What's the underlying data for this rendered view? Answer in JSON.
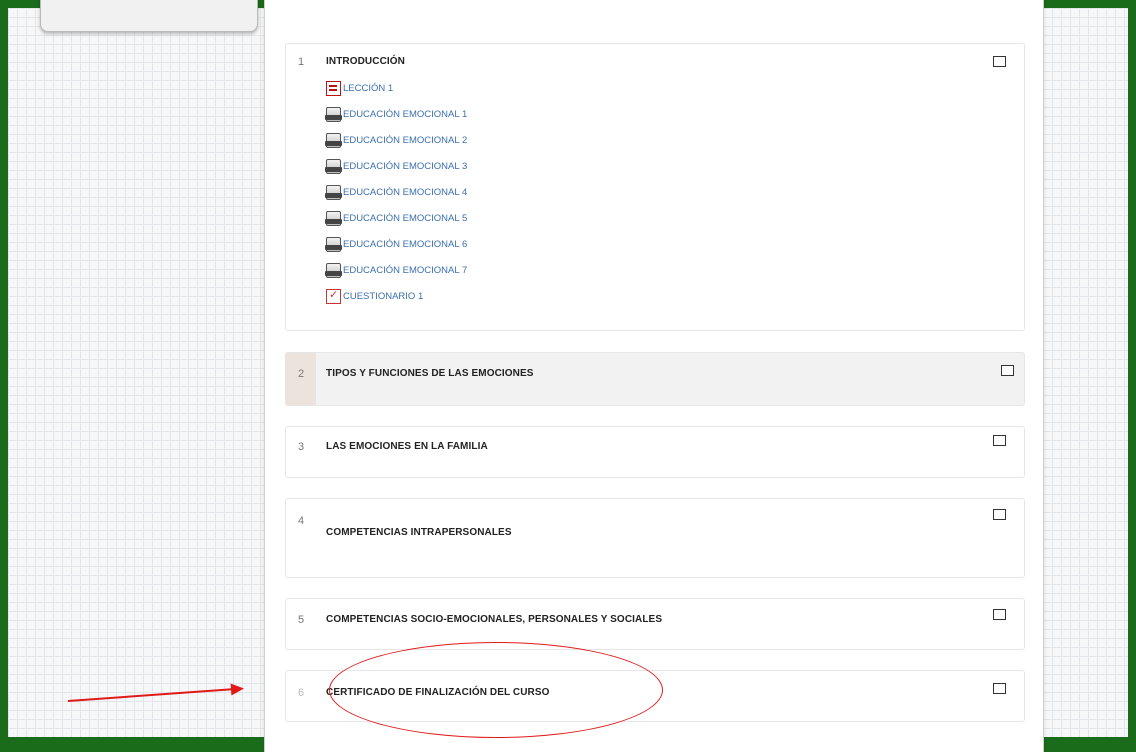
{
  "sections": [
    {
      "number": "1",
      "title": "INTRODUCCIÓN"
    },
    {
      "number": "2",
      "title": "TIPOS Y FUNCIONES DE LAS EMOCIONES"
    },
    {
      "number": "3",
      "title": "LAS EMOCIONES EN LA FAMILIA"
    },
    {
      "number": "4",
      "title": "COMPETENCIAS INTRAPERSONALES"
    },
    {
      "number": "5",
      "title": "COMPETENCIAS SOCIO-EMOCIONALES, PERSONALES Y SOCIALES"
    },
    {
      "number": "6",
      "title": "CERTIFICADO DE FINALIZACIÓN DEL CURSO"
    }
  ],
  "activities": [
    {
      "label": "LECCIÓN 1",
      "icon": "lesson-icon"
    },
    {
      "label": "EDUCACIÓN EMOCIONAL 1",
      "icon": "document-icon"
    },
    {
      "label": "EDUCACIÓN EMOCIONAL 2",
      "icon": "document-icon"
    },
    {
      "label": "EDUCACIÓN EMOCIONAL 3",
      "icon": "document-icon"
    },
    {
      "label": "EDUCACIÓN EMOCIONAL 4",
      "icon": "document-icon"
    },
    {
      "label": "EDUCACIÓN EMOCIONAL 5",
      "icon": "document-icon"
    },
    {
      "label": "EDUCACIÓN EMOCIONAL 6",
      "icon": "document-icon"
    },
    {
      "label": "EDUCACIÓN EMOCIONAL 7",
      "icon": "document-icon"
    },
    {
      "label": "CUESTIONARIO 1",
      "icon": "quiz-icon"
    }
  ],
  "colors": {
    "outer_border": "#1a6b1a",
    "link": "#3b6fae",
    "annotation": "#e01a1a"
  }
}
